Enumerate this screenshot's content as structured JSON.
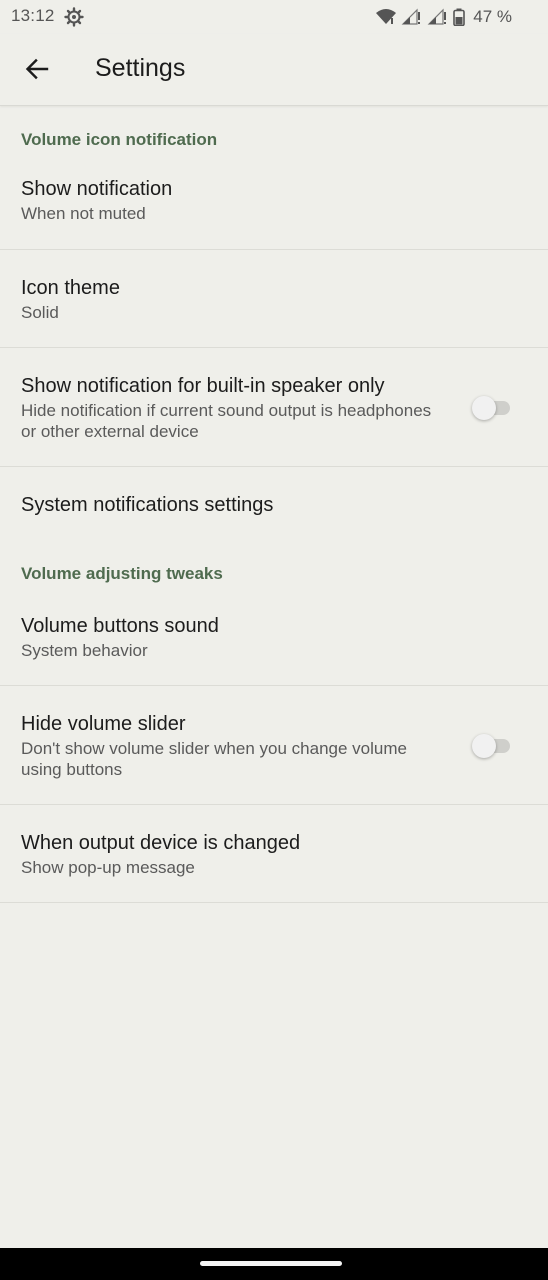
{
  "status_bar": {
    "time": "13:12",
    "battery": "47 %"
  },
  "app_bar": {
    "title": "Settings"
  },
  "sections": {
    "volume_icon": {
      "header": "Volume icon notification",
      "items": [
        {
          "title": "Show notification",
          "summary": "When not muted"
        },
        {
          "title": "Icon theme",
          "summary": "Solid"
        },
        {
          "title": "Show notification for built-in speaker only",
          "summary": "Hide notification if current sound output is headphones or other external device",
          "toggle": false
        },
        {
          "title": "System notifications settings"
        }
      ]
    },
    "volume_adjusting": {
      "header": "Volume adjusting tweaks",
      "items": [
        {
          "title": "Volume buttons sound",
          "summary": "System behavior"
        },
        {
          "title": "Hide volume slider",
          "summary": "Don't show volume slider when you change volume using buttons",
          "toggle": false
        },
        {
          "title": "When output device is changed",
          "summary": "Show pop-up message"
        }
      ]
    }
  },
  "colors": {
    "background": "#efefea",
    "accent": "#4f6b4f",
    "divider": "#dcdcd6"
  }
}
